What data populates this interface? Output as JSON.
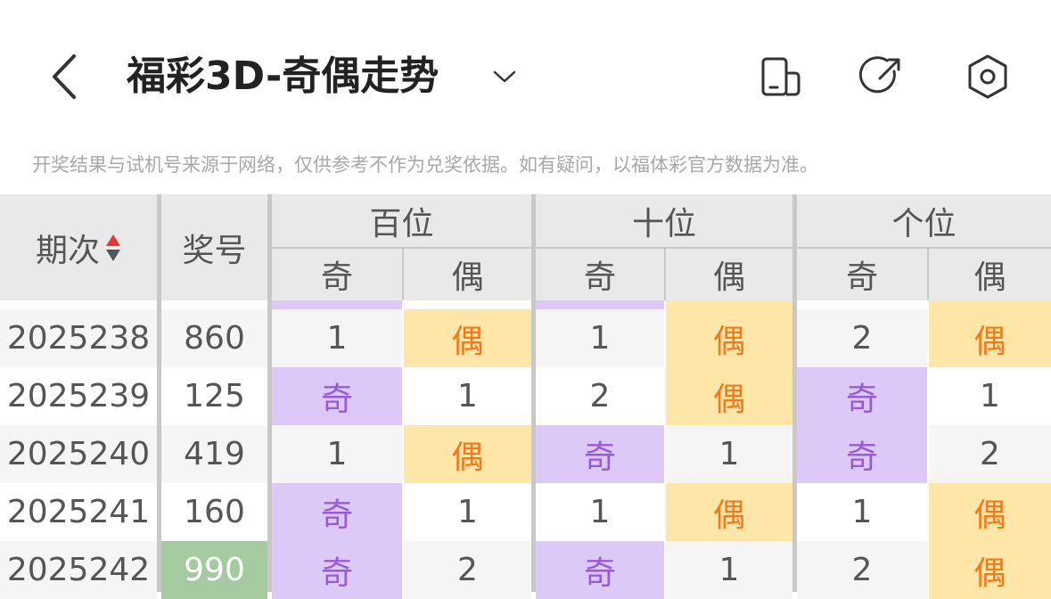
{
  "header": {
    "title": "福彩3D-奇偶走势",
    "icons": [
      "back-arrow-icon",
      "chevron-down-icon",
      "rotate-screen-icon",
      "share-icon",
      "settings-icon"
    ]
  },
  "notice": "开奖结果与试机号来源于网络，仅供参考不作为兑奖依据。如有疑问，以福体彩官方数据为准。",
  "table": {
    "col_period": "期次",
    "col_number": "奖号",
    "groups": [
      "百位",
      "十位",
      "个位"
    ],
    "sub_odd": "奇",
    "sub_even": "偶",
    "rows": [
      {
        "period": "2025238",
        "number": "860",
        "cells": [
          "1",
          "偶",
          "1",
          "偶",
          "2",
          "偶"
        ]
      },
      {
        "period": "2025239",
        "number": "125",
        "cells": [
          "奇",
          "1",
          "2",
          "偶",
          "奇",
          "1"
        ]
      },
      {
        "period": "2025240",
        "number": "419",
        "cells": [
          "1",
          "偶",
          "奇",
          "1",
          "奇",
          "2"
        ]
      },
      {
        "period": "2025241",
        "number": "160",
        "cells": [
          "奇",
          "1",
          "1",
          "偶",
          "1",
          "偶"
        ]
      },
      {
        "period": "2025242",
        "number": "990",
        "cells": [
          "奇",
          "2",
          "奇",
          "1",
          "2",
          "偶"
        ]
      }
    ]
  },
  "colors": {
    "odd_bg": "#dcc9f7",
    "odd_text": "#9a5ad6",
    "even_bg": "#fde6a8",
    "even_text": "#f07a1c",
    "highlight_number_bg": "#a5c9a0",
    "sort_up": "#e53935",
    "sort_down": "#555555"
  }
}
